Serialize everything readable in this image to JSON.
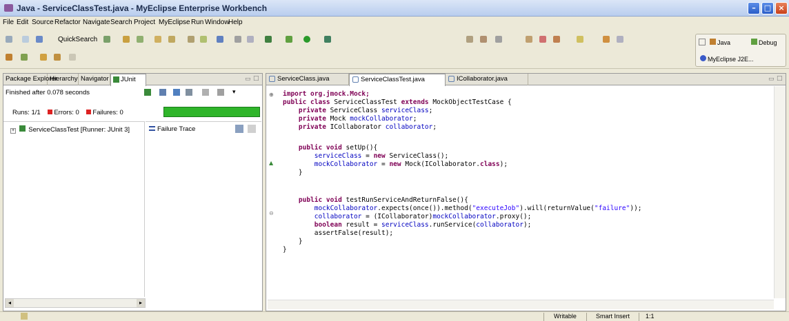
{
  "window": {
    "title": "Java - ServiceClassTest.java - MyEclipse Enterprise Workbench"
  },
  "menu": [
    "File",
    "Edit",
    "Source",
    "Refactor",
    "Navigate",
    "Search",
    "Project",
    "MyEclipse",
    "Run",
    "Window",
    "Help"
  ],
  "toolbar": {
    "quick_search": "QuickSearch"
  },
  "perspectives": {
    "java": "Java",
    "debug": "Debug",
    "myeclipse": "MyEclipse J2E..."
  },
  "left_tabs": [
    "Package Explorer",
    "Hierarchy",
    "Navigator",
    "JUnit"
  ],
  "junit": {
    "finished": "Finished after 0.078 seconds",
    "runs_label": "Runs:",
    "runs_value": "1/1",
    "errors_label": "Errors:",
    "errors_value": "0",
    "failures_label": "Failures:",
    "failures_value": "0",
    "progress": 1.0,
    "test_item": "ServiceClassTest [Runner: JUnit 3]",
    "failure_trace": "Failure Trace"
  },
  "editor_tabs": [
    "ServiceClass.java",
    "ServiceClassTest.java",
    "ICollaborator.java"
  ],
  "code": {
    "l01": "import org.jmock.Mock;",
    "l02a": "public class ",
    "l02b": "ServiceClassTest ",
    "l02c": "extends ",
    "l02d": "MockObjectTestCase {",
    "l03a": "    private ",
    "l03b": "ServiceClass ",
    "l03c": "serviceClass",
    "l04a": "    private ",
    "l04b": "Mock ",
    "l04c": "mockCollaborator",
    "l05a": "    private ",
    "l05b": "ICollaborator ",
    "l05c": "collaborator",
    "l06a": "    public void ",
    "l06b": "setUp(){",
    "l07a": "        ",
    "l07b": "serviceClass",
    "l07c": " = ",
    "l07d": "new ",
    "l07e": "ServiceClass();",
    "l08a": "        ",
    "l08b": "mockCollaborator",
    "l08c": " = ",
    "l08d": "new ",
    "l08e": "Mock(ICollaborator.",
    "l08f": "class",
    "l08g": ");",
    "l09": "    }",
    "l10a": "    public void ",
    "l10b": "testRunServiceAndReturnFalse(){",
    "l11a": "        ",
    "l11b": "mockCollaborator",
    "l11c": ".expects(once()).method(",
    "l11d": "\"executeJob\"",
    "l11e": ").will(returnValue(",
    "l11f": "\"failure\"",
    "l11g": "));",
    "l12a": "        ",
    "l12b": "collaborator",
    "l12c": " = (ICollaborator)",
    "l12d": "mockCollaborator",
    "l12e": ".proxy();",
    "l13a": "        ",
    "l13b": "boolean ",
    "l13c": "result = ",
    "l13d": "serviceClass",
    "l13e": ".runService(",
    "l13f": "collaborator",
    "l13g": ");",
    "l14": "        assertFalse(result);",
    "l15": "    }",
    "l16": "}"
  },
  "status": {
    "writable": "Writable",
    "insert": "Smart Insert",
    "position": "1:1"
  }
}
